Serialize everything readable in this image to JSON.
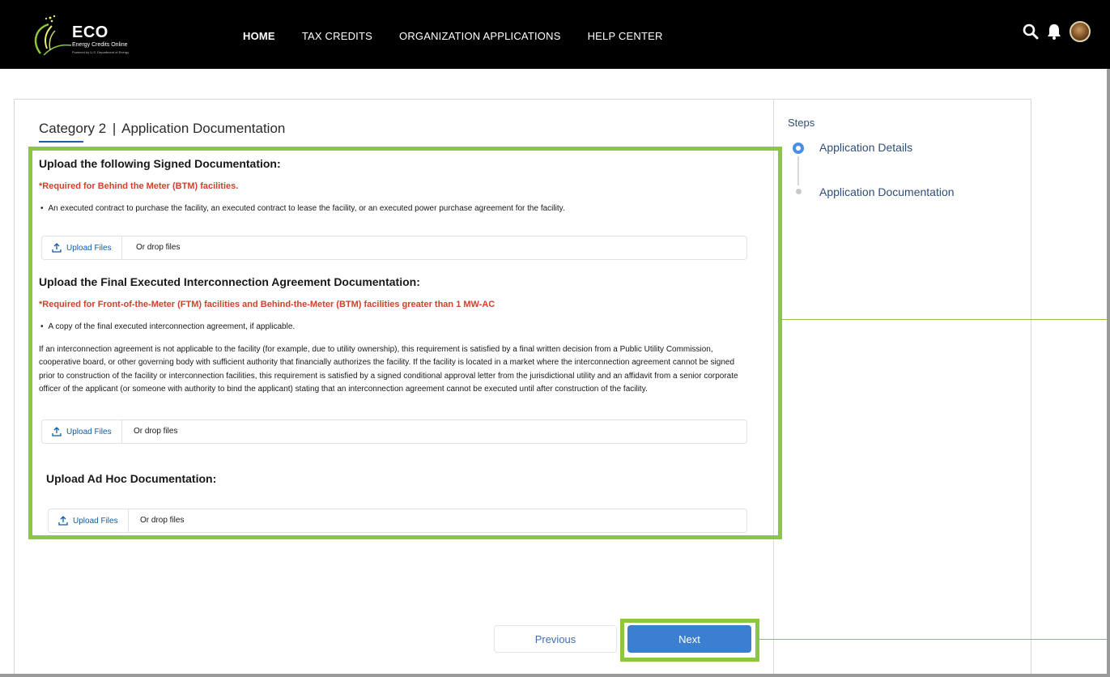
{
  "header": {
    "logo_title": "ECO",
    "logo_subtitle": "Energy Credits Online",
    "logo_tagline": "Powered by U.S. Department of Energy",
    "nav": [
      "HOME",
      "TAX CREDITS",
      "ORGANIZATION APPLICATIONS",
      "HELP CENTER"
    ],
    "active_nav": "HOME",
    "icons": [
      "search-icon",
      "bell-icon",
      "avatar"
    ]
  },
  "page": {
    "heading_prefix": "Category 2",
    "heading_separator": "|",
    "heading_title": "Application Documentation"
  },
  "sections": [
    {
      "title": "Upload the following Signed Documentation:",
      "required": "*Required for Behind the Meter (BTM) facilities.",
      "bullet": "An executed  contract to purchase the facility, an executed contract to lease the facility, or an executed power purchase agreement for the facility.",
      "upload_label": "Upload Files",
      "drop_label": "Or drop files"
    },
    {
      "title": "Upload the Final Executed Interconnection Agreement Documentation:",
      "required": "*Required for Front-of-the-Meter (FTM) facilities and Behind-the-Meter (BTM) facilities greater than 1 MW-AC",
      "bullet": "A copy of the final executed interconnection agreement, if applicable.",
      "paragraph": "If an interconnection agreement is not applicable to the facility (for example, due to utility ownership), this requirement is satisfied by a final written decision from a Public Utility Commission, cooperative board, or other governing body with sufficient authority that financially authorizes the facility. If the facility is located in a market where the interconnection agreement cannot be signed prior to construction of the facility or interconnection facilities, this requirement is satisfied by a signed conditional approval letter from the jurisdictional utility and an affidavit from a senior corporate officer of the applicant (or someone with authority to bind the applicant) stating that an interconnection agreement cannot be executed until after construction of the facility.",
      "upload_label": "Upload Files",
      "drop_label": "Or drop files"
    },
    {
      "title": "Upload Ad Hoc Documentation:",
      "upload_label": "Upload Files",
      "drop_label": "Or drop files"
    }
  ],
  "steps": {
    "title": "Steps",
    "items": [
      {
        "label": "Application Details",
        "state": "current"
      },
      {
        "label": "Application Documentation",
        "state": "upcoming"
      }
    ]
  },
  "buttons": {
    "previous": "Previous",
    "next": "Next"
  },
  "colors": {
    "highlight": "#8dc63f",
    "required": "#d0412c",
    "primary": "#3c7fd0",
    "link": "#0b5cab"
  }
}
